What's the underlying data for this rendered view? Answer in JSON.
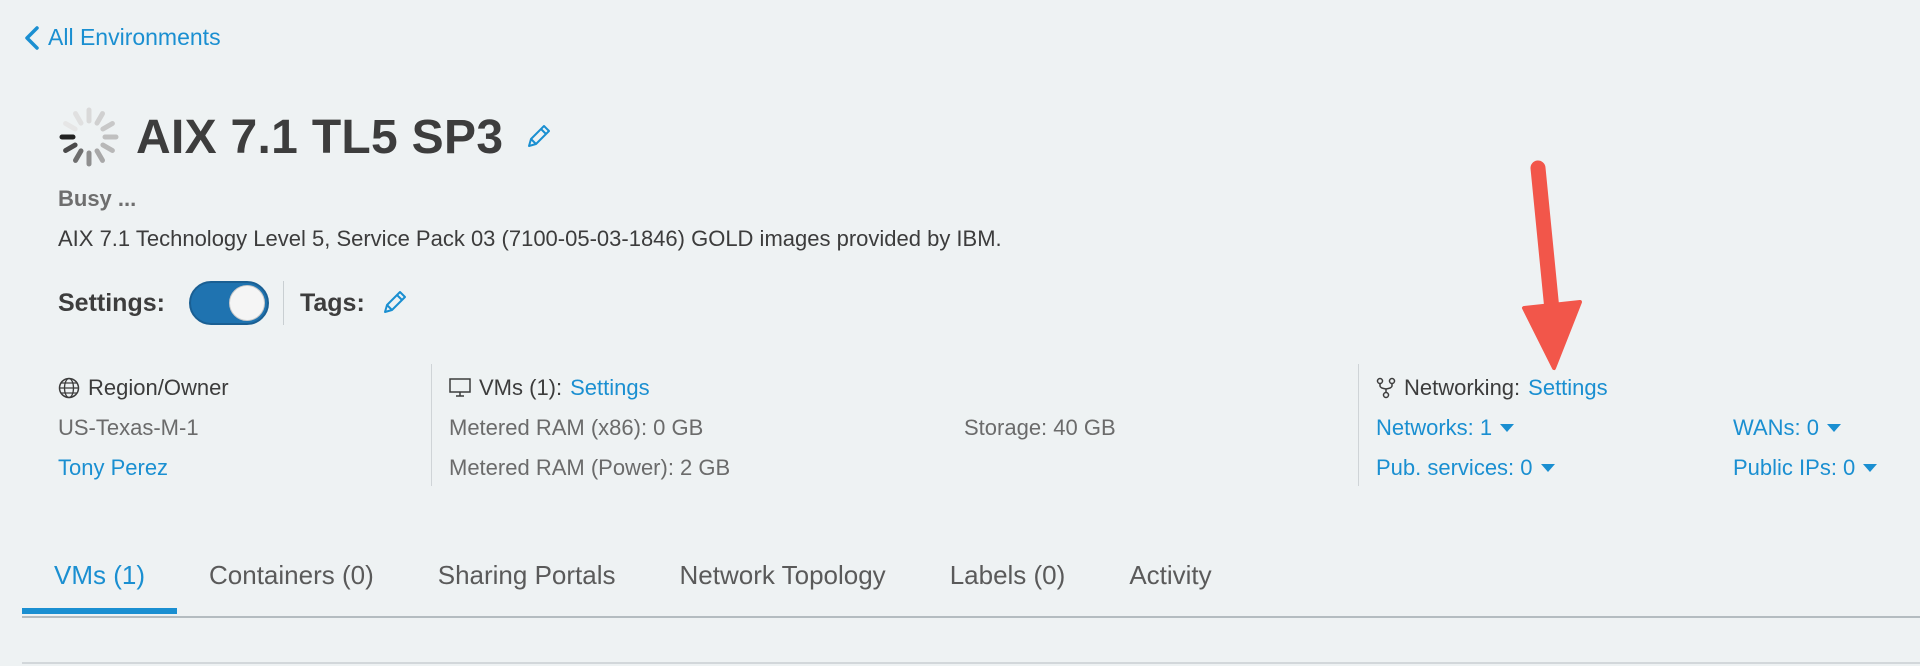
{
  "nav": {
    "back_label": "All Environments"
  },
  "environment": {
    "title": "AIX 7.1 TL5 SP3",
    "status": "Busy ...",
    "description": "AIX 7.1 Technology Level 5, Service Pack 03 (7100-05-03-1846) GOLD images provided by IBM."
  },
  "settings": {
    "label": "Settings:",
    "toggle_on": true
  },
  "tags": {
    "label": "Tags:"
  },
  "region": {
    "header": "Region/Owner",
    "region": "US-Texas-M-1",
    "owner": "Tony Perez"
  },
  "vms": {
    "header": "VMs (1):",
    "settings_link": "Settings",
    "ram_x86": "Metered RAM (x86): 0 GB",
    "ram_power": "Metered RAM (Power): 2 GB",
    "storage": "Storage: 40 GB"
  },
  "networking": {
    "header": "Networking:",
    "settings_link": "Settings",
    "networks": "Networks: 1",
    "pub_services": "Pub. services: 0",
    "wans": "WANs: 0",
    "public_ips": "Public IPs: 0"
  },
  "tabs": [
    {
      "label": "VMs (1)",
      "active": true
    },
    {
      "label": "Containers (0)"
    },
    {
      "label": "Sharing Portals"
    },
    {
      "label": "Network Topology"
    },
    {
      "label": "Labels (0)"
    },
    {
      "label": "Activity"
    }
  ],
  "colors": {
    "accent": "#1a8fd1",
    "toggle": "#1f73b0",
    "background": "#eef2f3",
    "annotation_arrow": "#f2564a"
  },
  "icons": {
    "back": "chevron-left-icon",
    "spinner": "loading-spinner-icon",
    "edit": "pencil-icon",
    "region": "globe-icon",
    "vms": "monitor-icon",
    "networking": "network-fork-icon"
  }
}
